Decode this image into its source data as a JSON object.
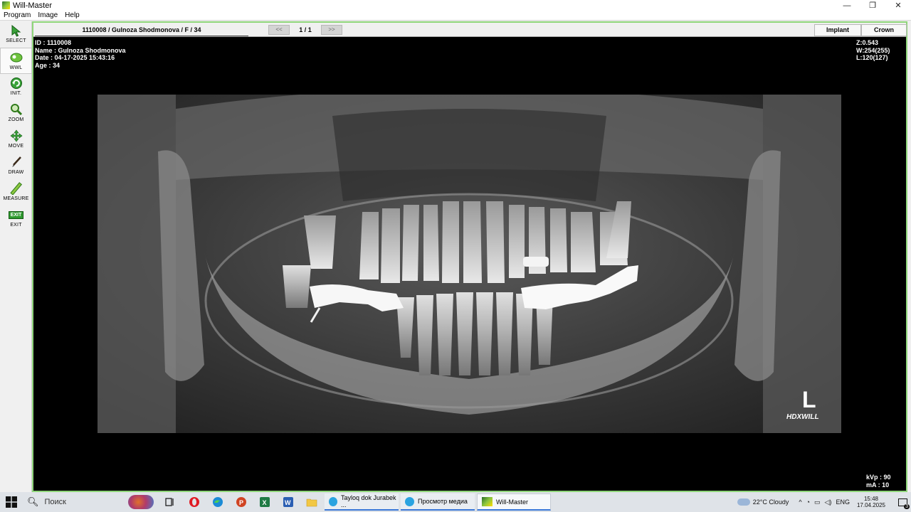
{
  "window": {
    "title": "Will-Master",
    "controls": {
      "minimize": "—",
      "maximize": "❐",
      "close": "✕"
    }
  },
  "menu": [
    "Program",
    "Image",
    "Help"
  ],
  "toolbar": [
    {
      "label": "SELECT",
      "icon": "select-arrow-icon",
      "active": false
    },
    {
      "label": "WWL",
      "icon": "wwl-icon",
      "active": true
    },
    {
      "label": "INIT.",
      "icon": "init-icon",
      "active": false
    },
    {
      "label": "ZOOM",
      "icon": "zoom-icon",
      "active": false
    },
    {
      "label": "MOVE",
      "icon": "move-icon",
      "active": false
    },
    {
      "label": "DRAW",
      "icon": "draw-icon",
      "active": false
    },
    {
      "label": "MEASURE",
      "icon": "measure-icon",
      "active": false
    },
    {
      "label": "EXIT",
      "icon": "exit-icon",
      "active": false,
      "badge": "EXIT"
    }
  ],
  "viewer": {
    "patient_tab": "1110008 / Gulnoza Shodmonova / F / 34",
    "prev_label": "<<",
    "next_label": ">>",
    "page": "1 / 1",
    "modes": [
      "Implant",
      "Crown"
    ]
  },
  "info_top_left": [
    "ID : 1110008",
    "Name : Gulnoza Shodmonova",
    "Date : 04-17-2025 15:43:16",
    "Age : 34"
  ],
  "info_top_right": [
    "Z:0.543",
    "W:254(255)",
    "L:120(127)"
  ],
  "info_bottom_right": [
    "kVp : 90",
    "mA : 10"
  ],
  "image_marker": {
    "side": "L",
    "brand": "HDXWILL"
  },
  "taskbar": {
    "search_placeholder": "Поиск",
    "apps": [
      {
        "label": "Tayloq dok Jurabek ...",
        "icon": "telegram-icon"
      },
      {
        "label": "Просмотр медиа",
        "icon": "telegram-icon"
      },
      {
        "label": "Will-Master",
        "icon": "willmaster-icon",
        "active": true
      }
    ],
    "weather": "22°C  Cloudy",
    "language": "ENG",
    "time": "15:48",
    "date": "17.04.2025",
    "notification_count": "3"
  }
}
